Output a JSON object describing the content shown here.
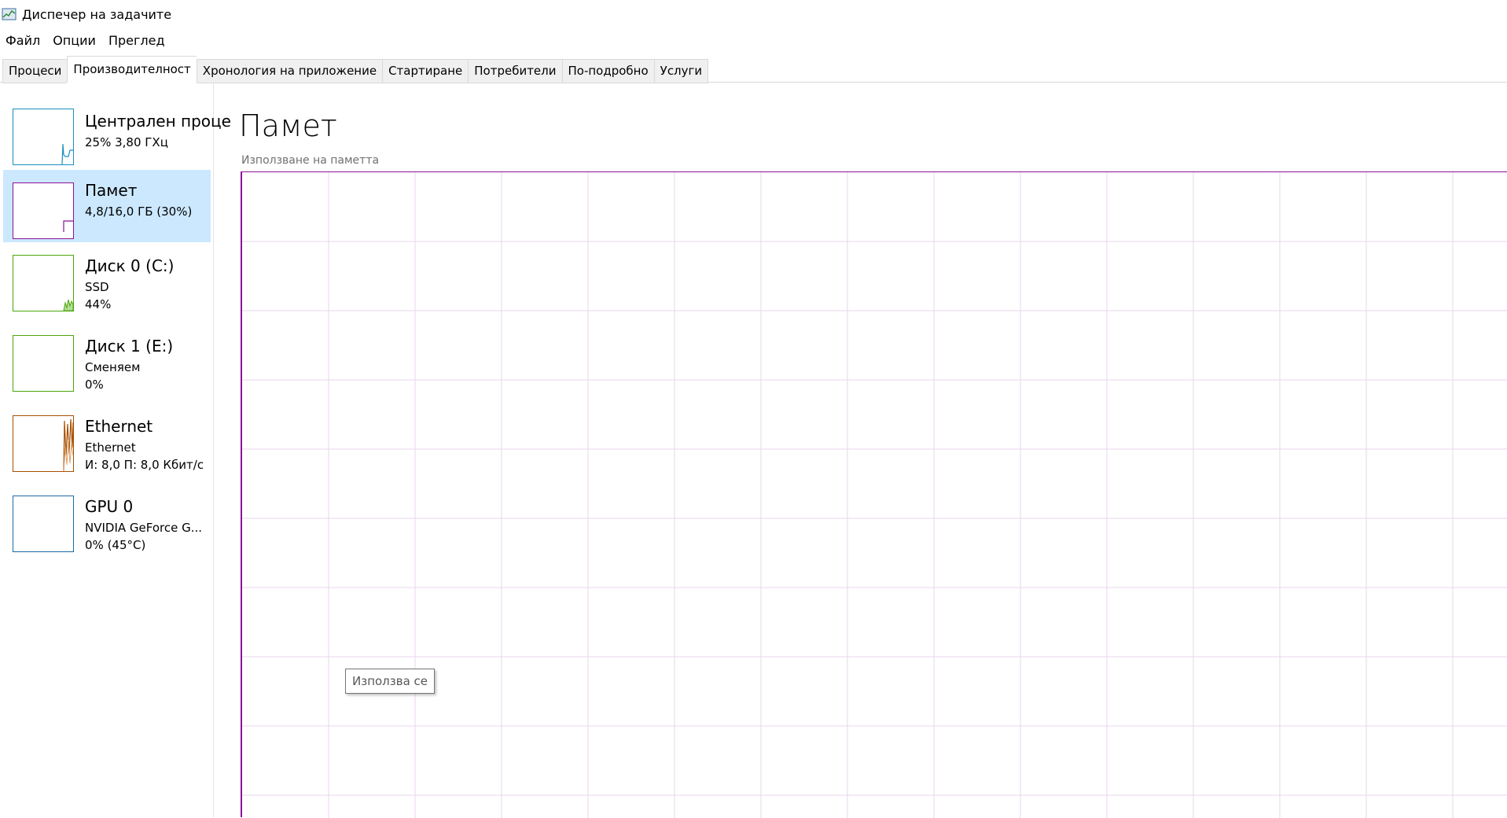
{
  "window": {
    "title": "Диспечер на задачите"
  },
  "menu": [
    "Файл",
    "Опции",
    "Преглед"
  ],
  "tabs": [
    {
      "label": "Процеси",
      "active": false
    },
    {
      "label": "Производителност",
      "active": true
    },
    {
      "label": "Хронология на приложение",
      "active": false
    },
    {
      "label": "Стартиране",
      "active": false
    },
    {
      "label": "Потребители",
      "active": false
    },
    {
      "label": "По-подробно",
      "active": false
    },
    {
      "label": "Услуги",
      "active": false
    }
  ],
  "sidebar": {
    "items": [
      {
        "title": "Централен проце",
        "line1": "25% 3,80 ГХц",
        "line2": "",
        "color": "#1b8fbf",
        "selected": false
      },
      {
        "title": "Памет",
        "line1": "4,8/16,0 ГБ (30%)",
        "line2": "",
        "color": "#8b1297",
        "selected": true
      },
      {
        "title": "Диск 0 (C:)",
        "line1": "SSD",
        "line2": "44%",
        "color": "#4da60c",
        "selected": false
      },
      {
        "title": "Диск 1 (E:)",
        "line1": "Сменяем",
        "line2": "0%",
        "color": "#4da60c",
        "selected": false
      },
      {
        "title": "Ethernet",
        "line1": "Ethernet",
        "line2": "И: 8,0 П: 8,0 Кбит/с",
        "color": "#a74f01",
        "selected": false
      },
      {
        "title": "GPU 0",
        "line1": "NVIDIA GeForce G...",
        "line2": "0% (45°C)",
        "color": "#1b6aa5",
        "selected": false
      }
    ]
  },
  "main": {
    "title": "Памет",
    "chart_label": "Използване на паметта",
    "tooltip": "Използва се"
  },
  "colors": {
    "memory_accent": "#8b1297",
    "grid": "#e9d6ec",
    "selected_bg": "#cce8ff"
  }
}
